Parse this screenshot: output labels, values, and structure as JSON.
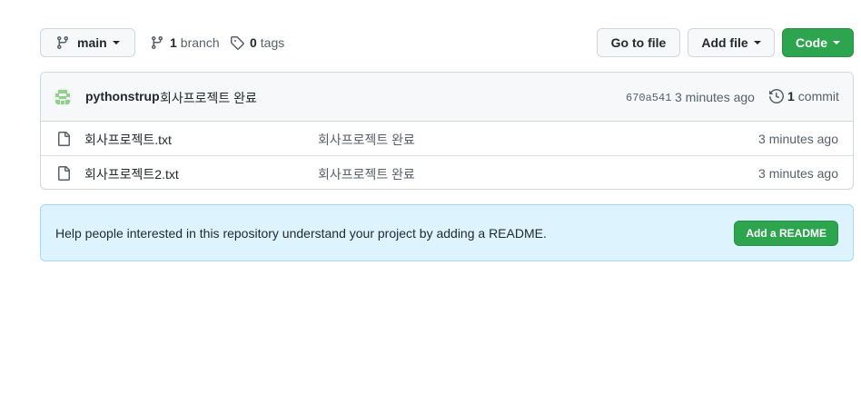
{
  "toolbar": {
    "branch_name": "main",
    "branch_count": "1",
    "branch_label": "branch",
    "tag_count": "0",
    "tag_label": "tags",
    "go_to_file": "Go to file",
    "add_file": "Add file",
    "code": "Code"
  },
  "commit": {
    "author": "pythonstrup",
    "message": "회사프로젝트 완료",
    "sha": "670a541",
    "time": "3 minutes ago",
    "count": "1",
    "count_label": "commit"
  },
  "files": [
    {
      "name": "회사프로젝트.txt",
      "message": "회사프로젝트 완료",
      "time": "3 minutes ago"
    },
    {
      "name": "회사프로젝트2.txt",
      "message": "회사프로젝트 완료",
      "time": "3 minutes ago"
    }
  ],
  "readme": {
    "text": "Help people interested in this repository understand your project by adding a README.",
    "button": "Add a README"
  },
  "colors": {
    "primary_green": "#2da44e",
    "readme_bg": "#ddf4ff",
    "border": "#d0d7de"
  },
  "icons": [
    "git-branch-icon",
    "tag-icon",
    "history-icon",
    "file-icon",
    "avatar-identicon"
  ]
}
